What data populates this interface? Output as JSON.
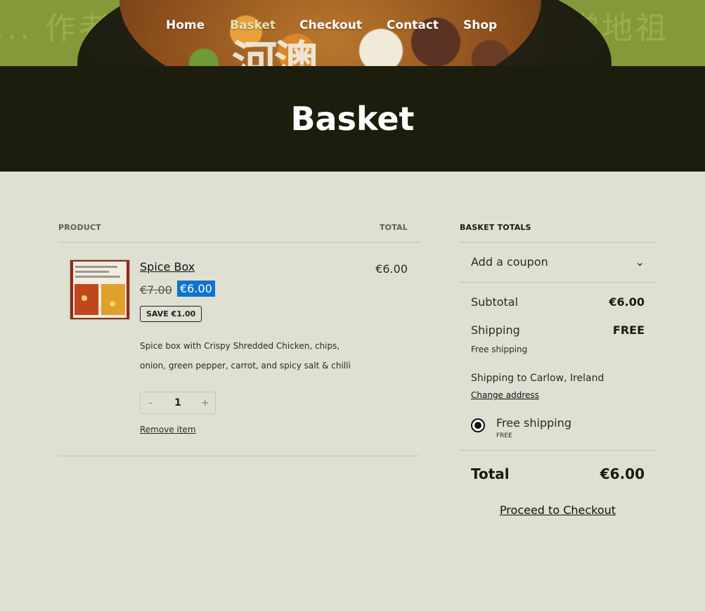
{
  "nav": {
    "items": [
      {
        "label": "Home"
      },
      {
        "label": "Basket",
        "active": true
      },
      {
        "label": "Checkout"
      },
      {
        "label": "Contact"
      },
      {
        "label": "Shop"
      }
    ]
  },
  "hero": {
    "bg_text_left": "... 作者",
    "bg_text_right": "為當地祖"
  },
  "page": {
    "title": "Basket"
  },
  "cart": {
    "columns": {
      "product": "PRODUCT",
      "total": "TOTAL"
    },
    "item": {
      "name": "Spice Box",
      "price_old": "€7.00",
      "price_new": "€6.00",
      "save_badge": "SAVE €1.00",
      "description": "Spice box with Crispy Shredded Chicken, chips, onion, green pepper, carrot, and spicy salt & chilli",
      "qty_minus": "-",
      "quantity": "1",
      "qty_plus": "+",
      "remove_label": "Remove item",
      "line_total": "€6.00"
    }
  },
  "totals": {
    "heading": "BASKET TOTALS",
    "coupon_label": "Add a coupon",
    "subtotal_label": "Subtotal",
    "subtotal_value": "€6.00",
    "shipping_label": "Shipping",
    "shipping_value": "FREE",
    "shipping_method": "Free shipping",
    "shipping_to": "Shipping to Carlow, Ireland",
    "change_address": "Change address",
    "radio_label": "Free shipping",
    "radio_sub": "FREE",
    "total_label": "Total",
    "total_value": "€6.00",
    "checkout_label": "Proceed to Checkout"
  },
  "colors": {
    "page_bg": "#dfdfd2",
    "title_bar_bg": "#1c1d0c",
    "price_highlight": "#0b74cf",
    "hero_green": "#849a3a"
  }
}
